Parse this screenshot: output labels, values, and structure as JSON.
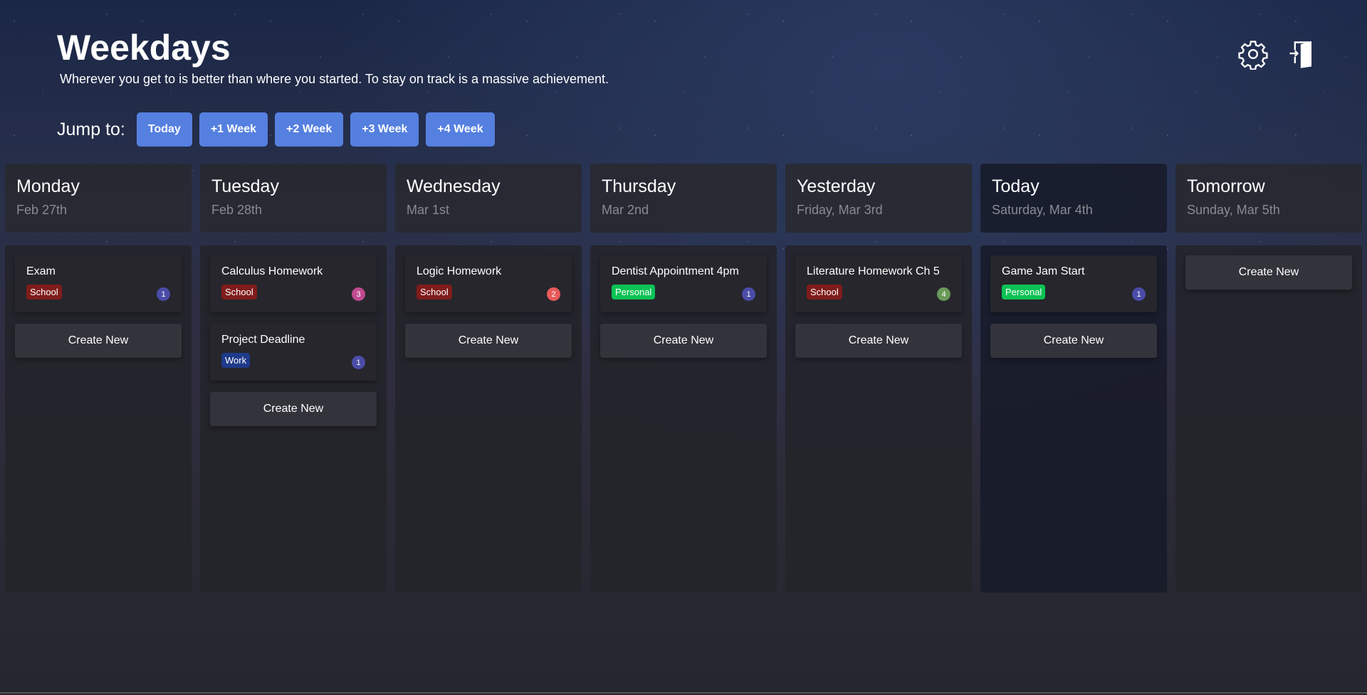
{
  "header": {
    "title": "Weekdays",
    "subtitle": "Wherever you get to is better than where you started. To stay on track is a massive achievement.",
    "jump_label": "Jump to:",
    "jump_buttons": [
      "Today",
      "+1 Week",
      "+2 Week",
      "+3 Week",
      "+4 Week"
    ],
    "icons": [
      "gear-icon",
      "logout-door-icon"
    ]
  },
  "colors": {
    "accent": "#5580e0",
    "School": "#801c1c",
    "Work": "#1f3a8a",
    "Personal": "#0cc254"
  },
  "create_label": "Create New",
  "columns": [
    {
      "title": "Monday",
      "subtitle": "Feb 27th",
      "cards": [
        {
          "title": "Exam",
          "tag": "School",
          "count": "1",
          "count_color": "#4b4ca8"
        }
      ]
    },
    {
      "title": "Tuesday",
      "subtitle": "Feb 28th",
      "cards": [
        {
          "title": "Calculus Homework",
          "tag": "School",
          "count": "3",
          "count_color": "#c04a90"
        },
        {
          "title": "Project Deadline",
          "tag": "Work",
          "count": "1",
          "count_color": "#4b4ca8"
        }
      ]
    },
    {
      "title": "Wednesday",
      "subtitle": "Mar 1st",
      "cards": [
        {
          "title": "Logic Homework",
          "tag": "School",
          "count": "2",
          "count_color": "#e85a5a"
        }
      ]
    },
    {
      "title": "Thursday",
      "subtitle": "Mar 2nd",
      "cards": [
        {
          "title": "Dentist Appointment 4pm",
          "tag": "Personal",
          "count": "1",
          "count_color": "#4b4ca8"
        }
      ]
    },
    {
      "title": "Yesterday",
      "subtitle": "Friday, Mar 3rd",
      "cards": [
        {
          "title": "Literature Homework Ch 5",
          "tag": "School",
          "count": "4",
          "count_color": "#6a9a5a"
        }
      ]
    },
    {
      "title": "Today",
      "subtitle": "Saturday, Mar 4th",
      "today": true,
      "cards": [
        {
          "title": "Game Jam Start",
          "tag": "Personal",
          "count": "1",
          "count_color": "#4b4ca8"
        }
      ]
    },
    {
      "title": "Tomorrow",
      "subtitle": "Sunday, Mar 5th",
      "cards": []
    }
  ]
}
